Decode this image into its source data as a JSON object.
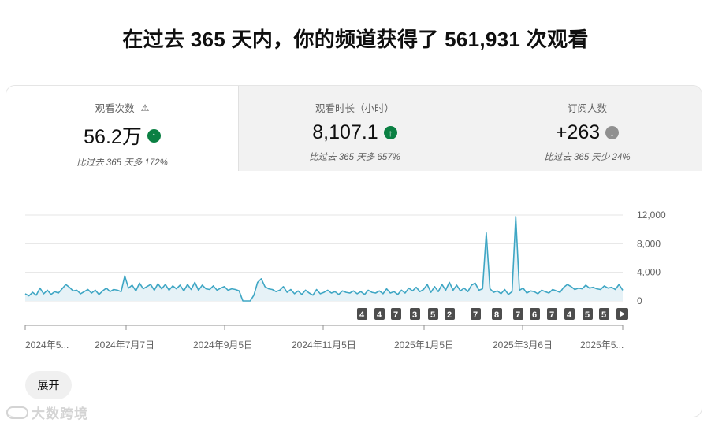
{
  "headline": "在过去 365 天内，你的频道获得了 561,931 次观看",
  "metrics": [
    {
      "label": "观看次数",
      "value": "56.2万",
      "trend": "up",
      "comparison": "比过去 365 天多 172%",
      "warning_icon": "warning-icon"
    },
    {
      "label": "观看时长（小时）",
      "value": "8,107.1",
      "trend": "up",
      "comparison": "比过去 365 天多 657%"
    },
    {
      "label": "订阅人数",
      "value": "+263",
      "trend": "down",
      "comparison": "比过去 365 天少 24%"
    }
  ],
  "colors": {
    "line": "#3ea6c4",
    "fill": "#e6f2f7",
    "up": "#0b8043",
    "down": "#909090",
    "marker": "#4d4d4d"
  },
  "chart_data": {
    "type": "area",
    "ylim": [
      0,
      12000
    ],
    "y_ticks": [
      "12,000",
      "8,000",
      "4,000",
      "0"
    ],
    "x_tick_labels": [
      "2024年5...",
      "2024年7月7日",
      "2024年9月5日",
      "2024年11月5日",
      "2025年1月5日",
      "2025年3月6日",
      "2025年5..."
    ],
    "grid": true,
    "series": [
      {
        "values": [
          1000,
          700,
          1200,
          800,
          1800,
          1000,
          1500,
          900,
          1300,
          1100,
          1700,
          2300,
          1900,
          1400,
          1500,
          1000,
          1300,
          1600,
          1100,
          1500,
          900,
          1400,
          1800,
          1300,
          1600,
          1500,
          1300,
          3500,
          1800,
          2200,
          1400,
          2500,
          1700,
          2000,
          2300,
          1500,
          2400,
          1700,
          2300,
          1500,
          2100,
          1700,
          2200,
          1400,
          2300,
          1600,
          2600,
          1500,
          2200,
          1700,
          1600,
          2100,
          1500,
          1800,
          2000,
          1500,
          1700,
          1600,
          1400,
          0,
          0,
          0,
          800,
          2600,
          3100,
          2000,
          1700,
          1600,
          1300,
          1500,
          2000,
          1200,
          1600,
          1000,
          1400,
          900,
          1500,
          1100,
          800,
          1600,
          1000,
          1200,
          1500,
          1100,
          1300,
          900,
          1400,
          1200,
          1100,
          1400,
          1000,
          1300,
          900,
          1500,
          1200,
          1100,
          1400,
          1000,
          1700,
          1100,
          1300,
          900,
          1500,
          1100,
          1800,
          1400,
          1900,
          1300,
          1600,
          2300,
          1200,
          2000,
          1300,
          2300,
          1500,
          2600,
          1500,
          2200,
          1400,
          1800,
          1300,
          2200,
          2500,
          1500,
          1700,
          9500,
          1700,
          1200,
          1400,
          1000,
          1600,
          900,
          1300,
          11800,
          1500,
          1800,
          1100,
          1400,
          1300,
          1000,
          1500,
          1300,
          1100,
          1600,
          1400,
          1200,
          1900,
          2300,
          2000,
          1600,
          1800,
          1700,
          2200,
          1800,
          1900,
          1700,
          1600,
          2100,
          1800,
          1900,
          1600,
          2300,
          1500
        ]
      }
    ],
    "markers": [
      "4",
      "4",
      "7",
      "3",
      "5",
      "2",
      "7",
      "8",
      "7",
      "6",
      "7",
      "4",
      "5",
      "5"
    ],
    "marker_play_icon": "play-icon"
  },
  "expand_label": "展开",
  "watermark": "大数跨境"
}
